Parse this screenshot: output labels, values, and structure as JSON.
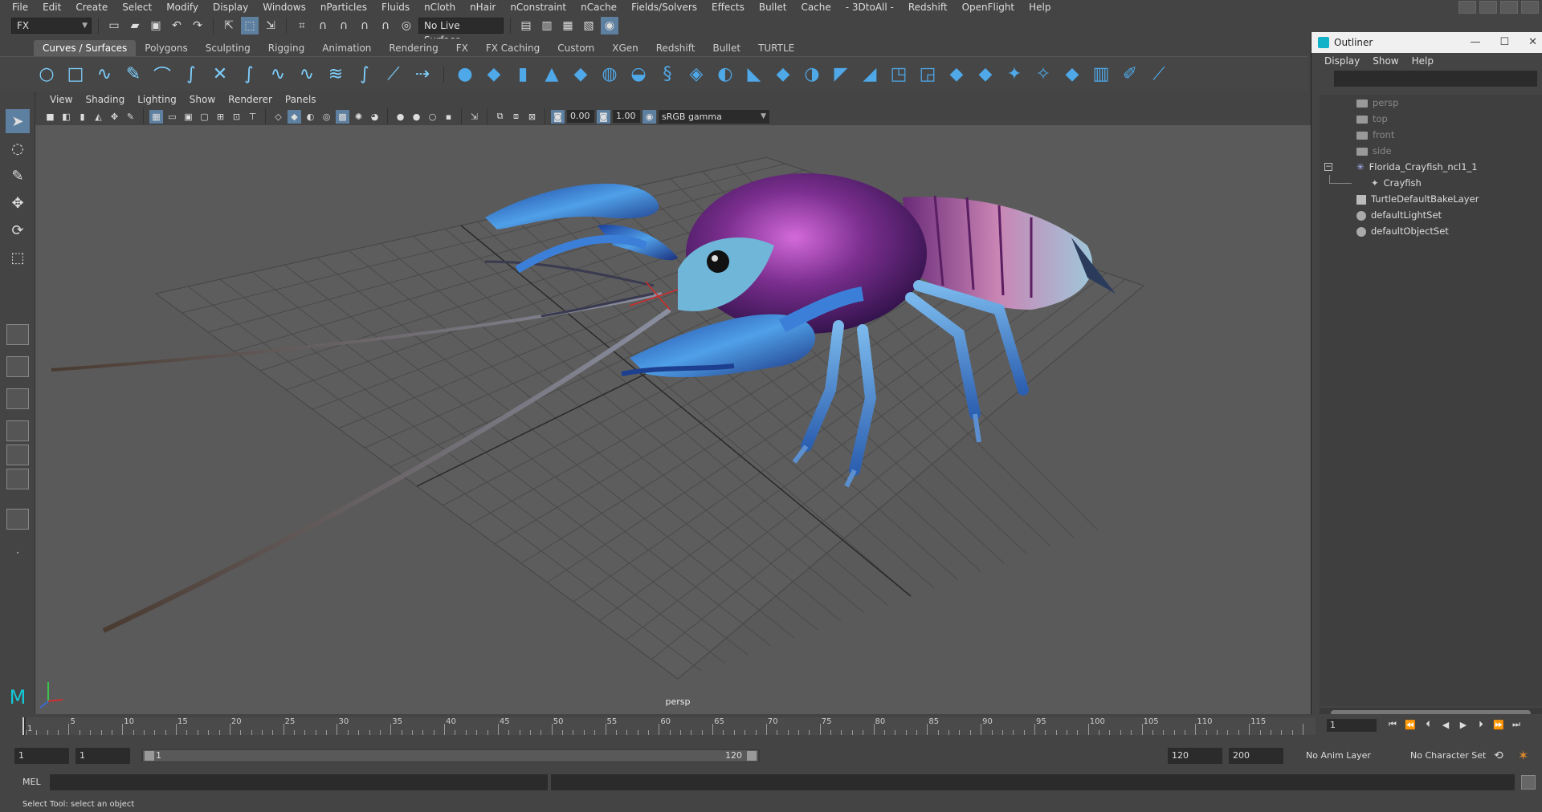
{
  "menubar": {
    "items": [
      "File",
      "Edit",
      "Create",
      "Select",
      "Modify",
      "Display",
      "Windows",
      "nParticles",
      "Fluids",
      "nCloth",
      "nHair",
      "nConstraint",
      "nCache",
      "Fields/Solvers",
      "Effects",
      "Bullet",
      "Cache",
      "- 3DtoAll -",
      "Redshift",
      "OpenFlight",
      "Help"
    ]
  },
  "statusline": {
    "menuset": "FX",
    "live_surface": "No Live Surface"
  },
  "shelf": {
    "tabs": [
      "Curves / Surfaces",
      "Polygons",
      "Sculpting",
      "Rigging",
      "Animation",
      "Rendering",
      "FX",
      "FX Caching",
      "Custom",
      "XGen",
      "Redshift",
      "Bullet",
      "TURTLE"
    ],
    "active_tab": "Curves / Surfaces"
  },
  "viewport": {
    "menu": [
      "View",
      "Shading",
      "Lighting",
      "Show",
      "Renderer",
      "Panels"
    ],
    "exposure": "0.00",
    "gamma": "1.00",
    "color_space": "sRGB gamma",
    "camera": "persp"
  },
  "outliner": {
    "title": "Outliner",
    "menu": [
      "Display",
      "Show",
      "Help"
    ],
    "items": [
      {
        "label": "persp",
        "type": "camera",
        "dim": true
      },
      {
        "label": "top",
        "type": "camera",
        "dim": true
      },
      {
        "label": "front",
        "type": "camera",
        "dim": true
      },
      {
        "label": "side",
        "type": "camera",
        "dim": true
      },
      {
        "label": "Florida_Crayfish_ncl1_1",
        "type": "group"
      },
      {
        "label": "Crayfish",
        "type": "mesh"
      },
      {
        "label": "TurtleDefaultBakeLayer",
        "type": "layer"
      },
      {
        "label": "defaultLightSet",
        "type": "set"
      },
      {
        "label": "defaultObjectSet",
        "type": "set"
      }
    ]
  },
  "timeline": {
    "start": 1,
    "end": 120,
    "current_frame": "1",
    "labels": [
      "5",
      "10",
      "15",
      "20",
      "25",
      "30",
      "35",
      "40",
      "45",
      "50",
      "55",
      "60",
      "65",
      "70",
      "75",
      "80",
      "85",
      "90",
      "95",
      "100",
      "105",
      "110",
      "115"
    ],
    "first_label": "1"
  },
  "range": {
    "anim_start": "1",
    "range_start": "1",
    "slider_start": "1",
    "slider_end": "120",
    "range_end": "120",
    "anim_end": "200",
    "anim_layer": "No Anim Layer",
    "character_set": "No Character Set"
  },
  "cmdline": {
    "language": "MEL"
  },
  "helpline": {
    "text": "Select Tool: select an object"
  },
  "colors": {
    "accent": "#5d7fa0",
    "viewport_bg": "#5a5a5a",
    "crayfish_body": "#7a2e8e",
    "crayfish_claws": "#3b7fd8"
  }
}
